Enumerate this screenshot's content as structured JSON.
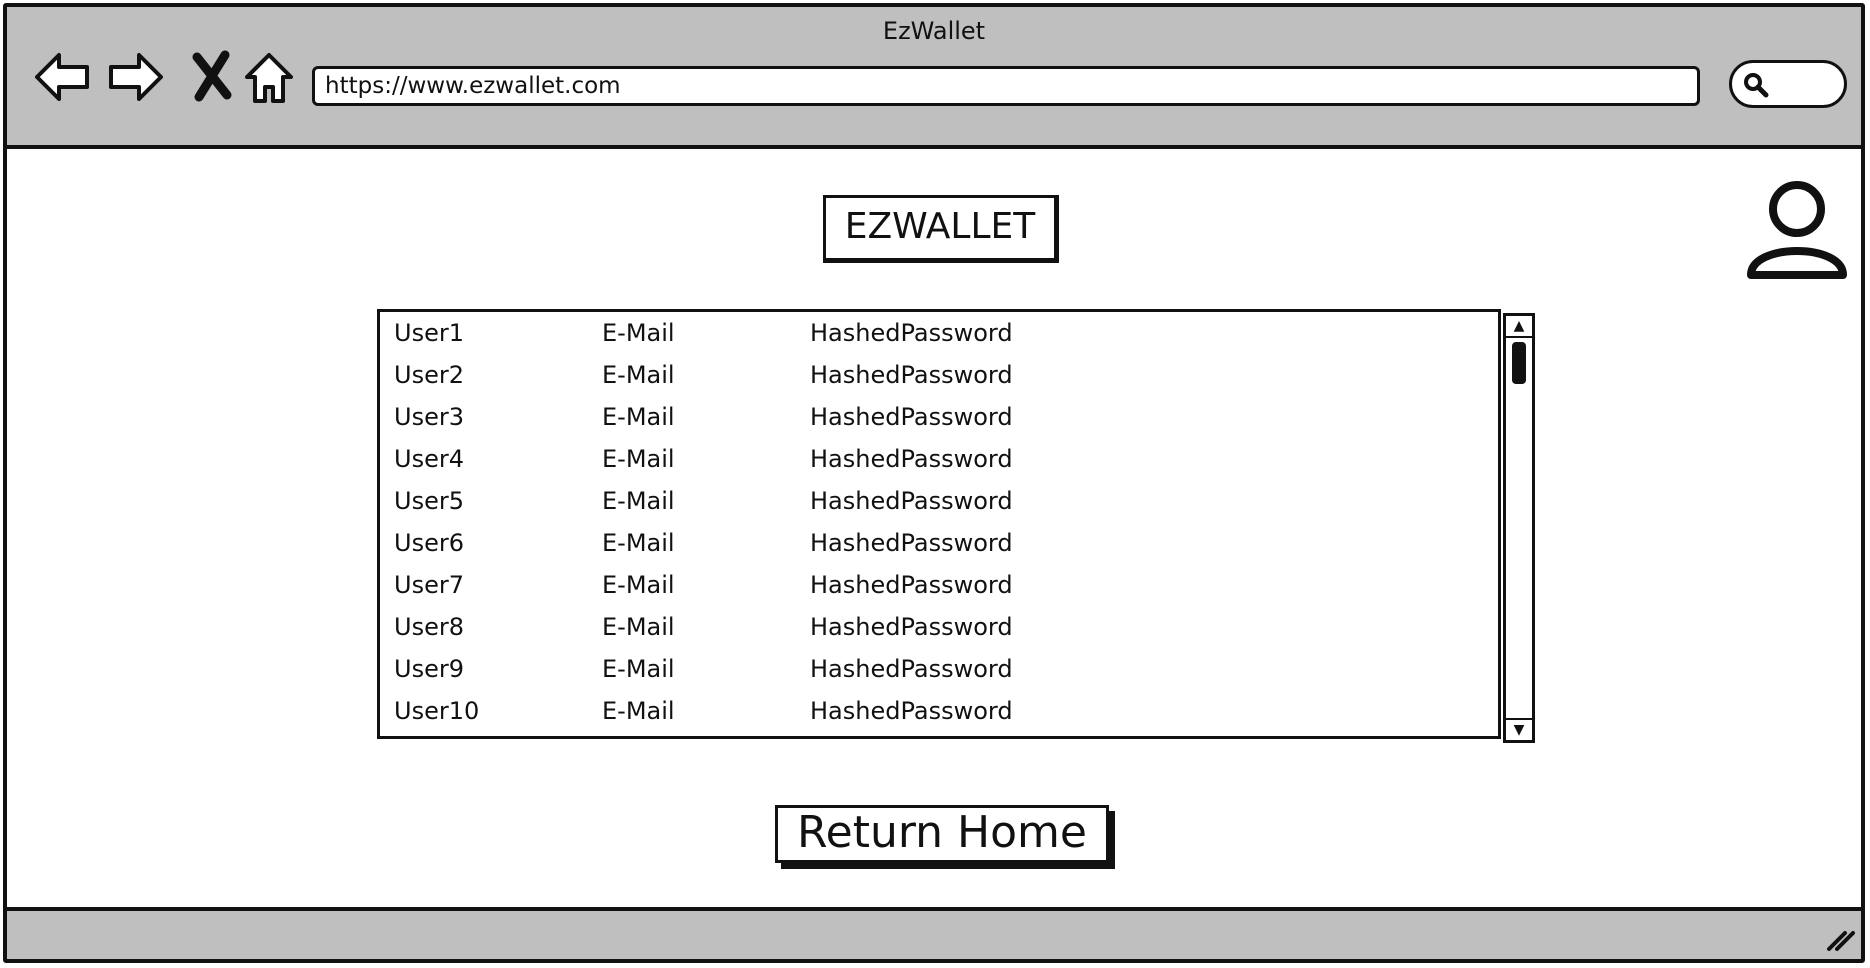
{
  "browser": {
    "title": "EzWallet",
    "url": "https://www.ezwallet.com",
    "icons": [
      "back-arrow-icon",
      "forward-arrow-icon",
      "stop-icon",
      "home-icon",
      "search-icon"
    ]
  },
  "header": {
    "logo_text": "EZWALLET",
    "avatar_icon": "user-icon"
  },
  "users_table": {
    "rows": [
      {
        "user": "User1",
        "email": "E-Mail",
        "password": "HashedPassword"
      },
      {
        "user": "User2",
        "email": "E-Mail",
        "password": "HashedPassword"
      },
      {
        "user": "User3",
        "email": "E-Mail",
        "password": "HashedPassword"
      },
      {
        "user": "User4",
        "email": "E-Mail",
        "password": "HashedPassword"
      },
      {
        "user": "User5",
        "email": "E-Mail",
        "password": "HashedPassword"
      },
      {
        "user": "User6",
        "email": "E-Mail",
        "password": "HashedPassword"
      },
      {
        "user": "User7",
        "email": "E-Mail",
        "password": "HashedPassword"
      },
      {
        "user": "User8",
        "email": "E-Mail",
        "password": "HashedPassword"
      },
      {
        "user": "User9",
        "email": "E-Mail",
        "password": "HashedPassword"
      },
      {
        "user": "User10",
        "email": "E-Mail",
        "password": "HashedPassword"
      }
    ]
  },
  "actions": {
    "return_home_label": "Return Home"
  }
}
